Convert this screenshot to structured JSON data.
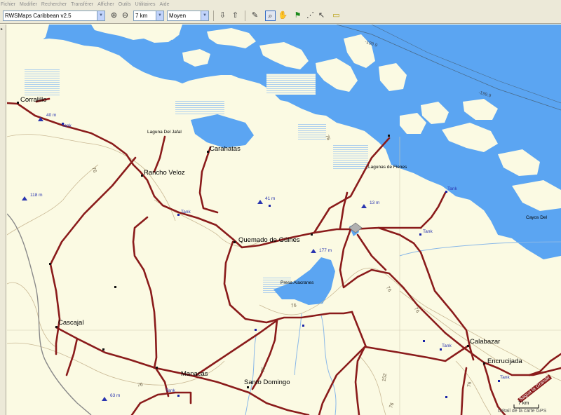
{
  "menu": {
    "items": [
      "Fichier",
      "Modifier",
      "Rechercher",
      "Transférer",
      "Afficher",
      "Outils",
      "Utilitaires",
      "Aide"
    ]
  },
  "toolbar": {
    "map_product": "RWSMaps Caribbean v2.5",
    "zoom": "7 km",
    "detail": "Moyen",
    "zoom_in_icon": "zoom-in-icon",
    "zoom_out_icon": "zoom-out-icon"
  },
  "map": {
    "colors": {
      "water": "#5ba5f2",
      "land": "#fbfae3",
      "road": "#8a1b1b",
      "contour": "#c9b894",
      "river": "#8ab8e8"
    },
    "towns": [
      {
        "id": "corralillo",
        "name": "Corralillo"
      },
      {
        "id": "carahatas",
        "name": "Carahatas"
      },
      {
        "id": "rancho-veloz",
        "name": "Rancho Veloz"
      },
      {
        "id": "quemado",
        "name": "Quemado de Güines"
      },
      {
        "id": "cascajal",
        "name": "Cascajal"
      },
      {
        "id": "calabazar",
        "name": "Calabazar"
      },
      {
        "id": "encrucijada",
        "name": "Encrucijada"
      },
      {
        "id": "manacas",
        "name": "Manacas"
      },
      {
        "id": "santo-domingo",
        "name": "Santo Domingo"
      }
    ],
    "features": {
      "laguna_jafal": "Laguna Del Jafal",
      "lagunas_fienes": "Lagunas de Fienes",
      "presa": "Presa Alacranes",
      "cayos": "Cayos Del"
    },
    "depths": [
      "-199.9",
      "-199.9"
    ],
    "summits": [
      "40 m",
      "118 m",
      "41 m",
      "13 m",
      "177 m",
      "63 m"
    ],
    "tanks": [
      "Tank",
      "Tank",
      "Tank",
      "Tank",
      "Tank",
      "Tank",
      "Tank"
    ],
    "contours": [
      "76",
      "76",
      "76",
      "76",
      "76",
      "76",
      "76",
      "76",
      "152",
      "76"
    ],
    "road_name": "Sagua la Grande"
  },
  "scale": {
    "label": "7 km",
    "caption": "Détail de la carte GPS"
  }
}
